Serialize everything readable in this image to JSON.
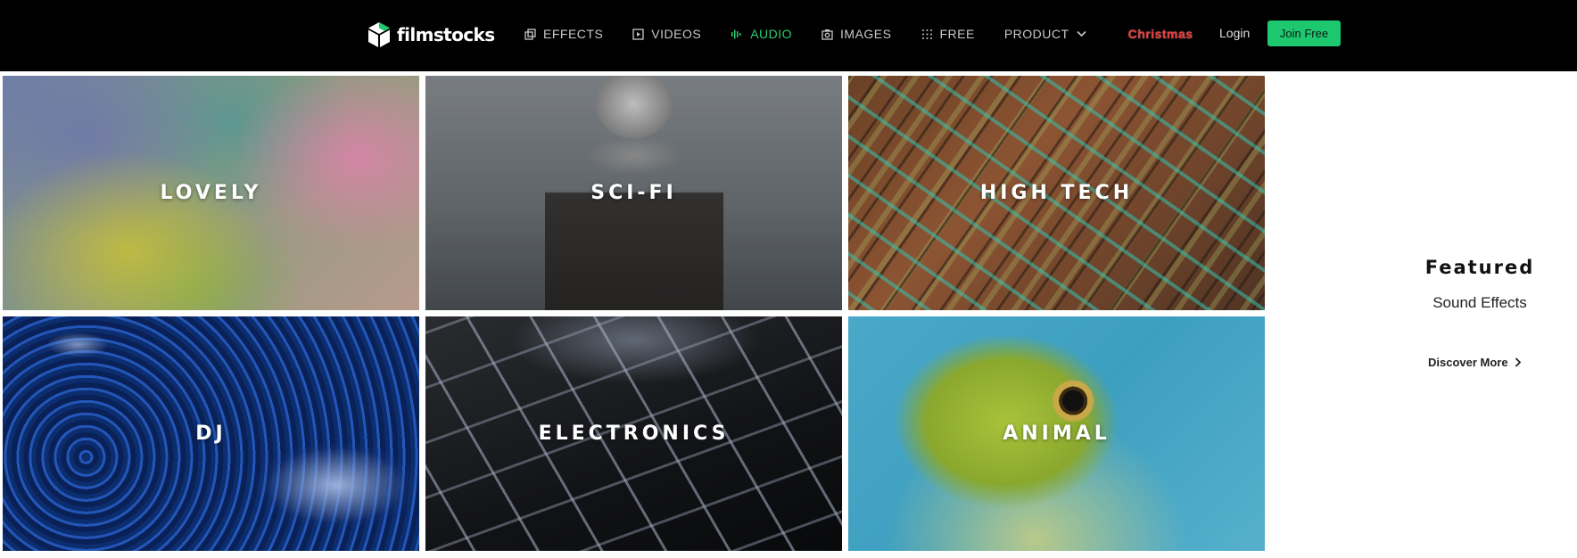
{
  "brand": {
    "name": "filmstocks"
  },
  "nav": {
    "items": [
      {
        "label": "EFFECTS",
        "icon": "effects-icon"
      },
      {
        "label": "VIDEOS",
        "icon": "play-square-icon"
      },
      {
        "label": "AUDIO",
        "icon": "audio-wave-icon",
        "active": true
      },
      {
        "label": "IMAGES",
        "icon": "camera-icon"
      },
      {
        "label": "FREE",
        "icon": "grid-dots-icon"
      },
      {
        "label": "PRODUCT",
        "icon": "chevron-down-icon"
      }
    ],
    "promo": "Christmas",
    "login": "Login",
    "join": "Join Free"
  },
  "tiles": [
    {
      "label": "LOVELY"
    },
    {
      "label": "SCI-FI"
    },
    {
      "label": "HIGH TECH"
    },
    {
      "label": "DJ"
    },
    {
      "label": "ELECTRONICS"
    },
    {
      "label": "ANIMAL"
    }
  ],
  "featured": {
    "title": "Featured",
    "subtitle": "Sound Effects",
    "cta": "Discover More"
  },
  "colors": {
    "topbar": "#000000",
    "accent": "#1ec86f",
    "active_nav": "#2ecc71",
    "promo": "#e23a3a"
  }
}
